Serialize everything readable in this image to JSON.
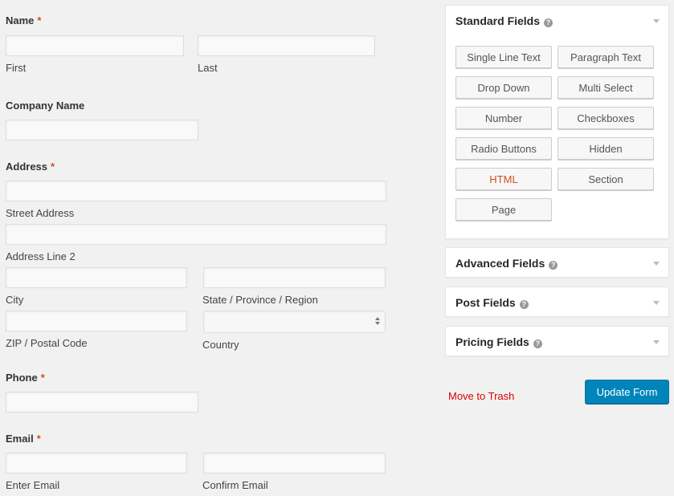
{
  "form": {
    "name": {
      "label": "Name",
      "required": "*",
      "first": "First",
      "last": "Last"
    },
    "company": {
      "label": "Company Name"
    },
    "address": {
      "label": "Address",
      "required": "*",
      "street": "Street Address",
      "line2": "Address Line 2",
      "city": "City",
      "state": "State / Province / Region",
      "zip": "ZIP / Postal Code",
      "country": "Country"
    },
    "phone": {
      "label": "Phone",
      "required": "*"
    },
    "email": {
      "label": "Email",
      "required": "*",
      "enter": "Enter Email",
      "confirm": "Confirm Email"
    }
  },
  "sidebar": {
    "standard": {
      "title": "Standard Fields",
      "buttons": [
        "Single Line Text",
        "Paragraph Text",
        "Drop Down",
        "Multi Select",
        "Number",
        "Checkboxes",
        "Radio Buttons",
        "Hidden",
        "HTML",
        "Section",
        "Page"
      ]
    },
    "advanced": {
      "title": "Advanced Fields"
    },
    "post": {
      "title": "Post Fields"
    },
    "pricing": {
      "title": "Pricing Fields"
    },
    "help_icon": "?",
    "move_to_trash": "Move to Trash",
    "update_form": "Update Form"
  },
  "colors": {
    "accent": "#0085ba",
    "required": "#d54e21",
    "trash": "#dd0000"
  }
}
